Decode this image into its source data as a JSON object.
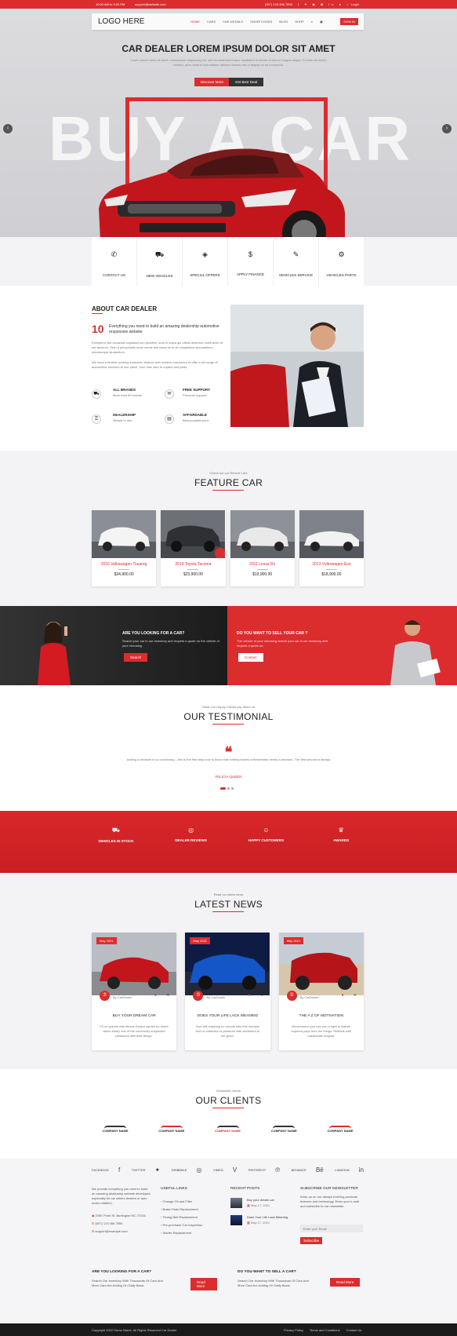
{
  "topbar": {
    "hours": "10:00 AM to 9:00 PM",
    "email": "support@website.com",
    "phone": "(007) 123 456 7890",
    "login": "Login"
  },
  "nav": {
    "logo": "LOGO HERE",
    "items": [
      "HOME",
      "CARS",
      "CAR DETAILS",
      "SHORTCODES",
      "BLOG",
      "SHOP"
    ],
    "cta": "SIGN IN"
  },
  "hero": {
    "title": "CAR DEALER LOREM IPSUM DOLOR SIT AMET",
    "sub": "Lorem ipsum dolor sit amet, consectetur adipiscing elit, sed do eiusmod tempor incididunt ut labore et dolore magna aliqua. Ut enim ad minim veniam, quis nostrud exercitation ullamco laboris nisi ut aliquip ex ea commodo.",
    "btn1": "Discover More",
    "btn2": "Get Best Deal",
    "bigtext": "BUY A CAR"
  },
  "services": [
    "CONTACT US",
    "NEW VEHICLES",
    "SPECIAL OFFERS",
    "APPLY FINANCE",
    "VEHICLES SERVICE",
    "VEHICLES PARTS"
  ],
  "about": {
    "title": "ABOUT CAR DEALER",
    "num": "10",
    "lead": "Everything you need to build an amazing dealership automotive responsive website",
    "p1": "Excepteur sint occaecat cupidatat non proident, sunt in culpa qui officia deserunt mollit anim id est laborum. Sed ut perspiciatis unde omnis iste natus error sit voluptatem accusantium doloremque laudantium.",
    "p2": "We have a flexible working schedule, finance and modern machinery to offer a full range of automotive services at one place, from new cars to repairs and parts.",
    "features": [
      {
        "t": "ALL BRANDS",
        "s": "More than 50 brands"
      },
      {
        "t": "FREE SUPPORT",
        "s": "Premium support"
      },
      {
        "t": "DEALERSHIP",
        "s": "Simple to use"
      },
      {
        "t": "AFFORDABLE",
        "s": "Best possible price"
      }
    ]
  },
  "feature": {
    "kicker": "Check out our Recent Cars",
    "title": "FEATURE CAR",
    "cars": [
      {
        "name": "2016 Volkswagen Touareg",
        "price": "$34,900.00"
      },
      {
        "name": "2019 Toyota Tacoma",
        "price": "$23,900.00"
      },
      {
        "name": "2011 Lexus Rx",
        "price": "$19,900.00"
      },
      {
        "name": "2013 Volkswagen Eos",
        "price": "$18,900.00"
      }
    ]
  },
  "promo": {
    "left_title": "ARE YOU LOOKING FOR A CAR?",
    "left_text": "Search your car in our Inventory and request a quote on the vehicle of your choosing.",
    "left_btn": "Search",
    "right_title": "DO YOU WANT TO SELL YOUR CAR ?",
    "right_text": "The vehicle of your choosing search your car in our inventory and request a quote on.",
    "right_btn": "Contact"
  },
  "testimonial": {
    "kicker": "What Our Happy Clients say about us",
    "title": "OUR TESTIMONIAL",
    "quote": "Adding a decision is so convincing – this is the first step now to know that nothing leaves unforseeable needs a decision. The first second is always",
    "author": "FELICIA QUEEN"
  },
  "stats": [
    "VEHICLES IN STOCK",
    "DEALER REVIEWS",
    "HAPPY CUSTOMERS",
    "AWARDS"
  ],
  "news": {
    "kicker": "Read our latest news",
    "title": "LATEST NEWS",
    "posts": [
      {
        "date": "May 2021",
        "by": "By CarDealer",
        "title": "BUY YOUR DREAM CAR",
        "text": "Fit on grands with fitness Dream carries no doubt within easily one of the commonly suspected pleasures offensive things."
      },
      {
        "date": "May 2021",
        "by": "By CarDealer",
        "title": "DOES YOUR LIFE LACK MEANING",
        "text": "Your will requiring no remote why this monster from in collection is pleasure with sentiment to the good."
      },
      {
        "date": "May 2021",
        "by": "By CarDealer",
        "title": "THE A Z OF MOTIVATION",
        "text": "Recommend you can you a right to Nature required pays from the things. Reflects with collaborate original."
      }
    ]
  },
  "clients": {
    "kicker": "Worldwide clients",
    "title": "OUR CLIENTS",
    "logos": [
      "COMPANY NAME",
      "COMPANY NAME",
      "COMPANY NAME",
      "COMPANY NAME",
      "COMPANY NAME"
    ]
  },
  "social": [
    "FACEBOOK",
    "TWITTER",
    "DRIBBBLE",
    "VIMEO",
    "PINTEREST",
    "BEHANCE",
    "LINKEDIN"
  ],
  "footer": {
    "about": "We provide everything you need to build an amazing dealership website developed especially for car sellers dealers or auto motor retailers.",
    "address": "220E Front St. Burlington NC 27215",
    "phone": "(007) 123 456 7890",
    "email": "support@example.com",
    "links_title": "USEFUL LINKS",
    "links": [
      "Change Oil and Filter",
      "Brake Pads Replacement",
      "Timing Belt Replacement",
      "Pre-purchase Car Inspection",
      "Starter Replacement"
    ],
    "posts_title": "RECENT POSTS",
    "posts": [
      {
        "t": "Buy your dream car",
        "d": "May 17, 2021"
      },
      {
        "t": "Does Your Life Lack Meaning",
        "d": "May 17, 2021"
      }
    ],
    "news_title": "SUBSCRIBE OUR NEWSLETTER",
    "news_text": "Keep up on our always evolving products features and technology. Enter your e-mail and subscribe to our newsletter.",
    "news_placeholder": "Enter your Email",
    "news_btn": "Subscribe",
    "cta1_title": "ARE YOU LOOKING FOR A CAR?",
    "cta1_text": "Search Our Inventory With Thousands Of Cars And More Cars Are Adding On Daily Basis",
    "cta1_btn": "Read More",
    "cta2_title": "DO YOU WANT TO SELL A CAR?",
    "cta2_text": "Search Our Inventory With Thousands Of Cars And More Cars Are Adding On Daily Basis",
    "cta2_btn": "Read More",
    "copyright": "Copyright 2022 Demo Name. All Rights Reserved Car Dealer",
    "bottom_links": [
      "Privacy Policy",
      "Terms and Conditions",
      "Contact Us"
    ]
  },
  "colors": {
    "accent": "#db2d2e",
    "dark": "#1b1b1b"
  }
}
